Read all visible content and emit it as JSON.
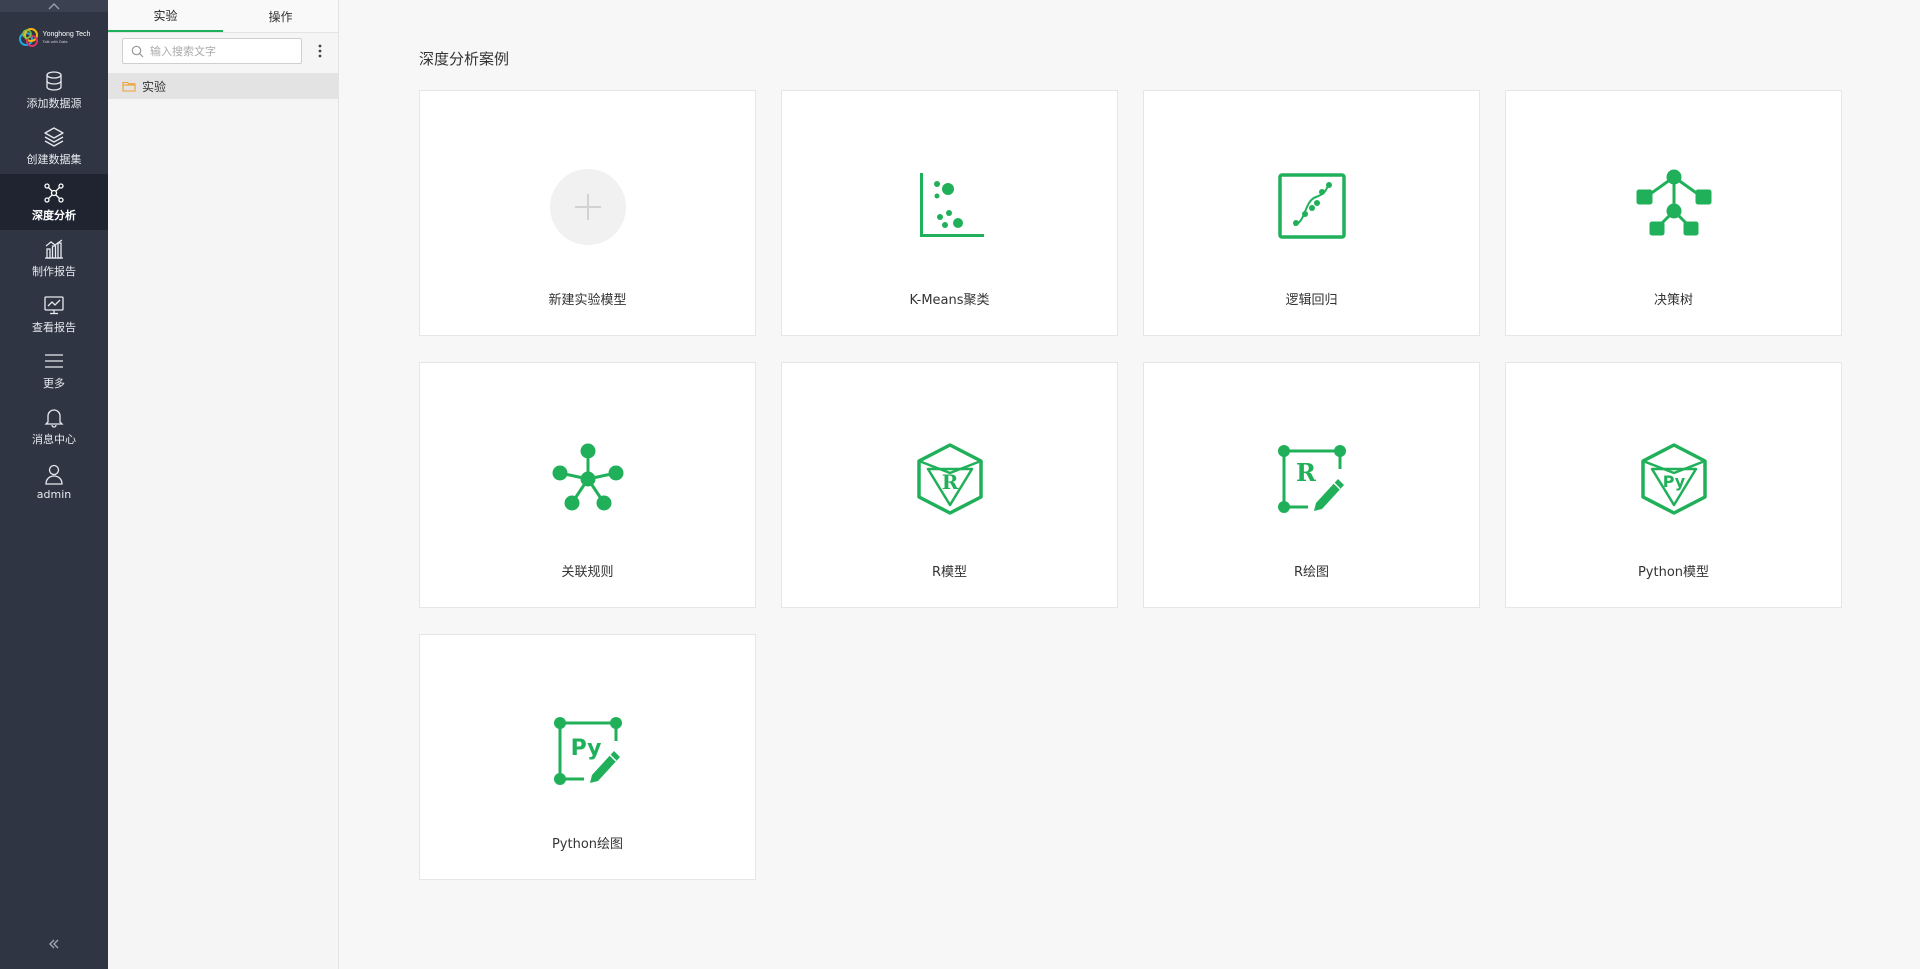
{
  "brand": {
    "name": "Yonghong Tech",
    "tagline": "Talk with Data"
  },
  "nav": {
    "items": [
      {
        "key": "add-datasource",
        "label": "添加数据源",
        "icon": "database-icon"
      },
      {
        "key": "create-dataset",
        "label": "创建数据集",
        "icon": "layers-icon"
      },
      {
        "key": "deep-analysis",
        "label": "深度分析",
        "icon": "network-icon",
        "active": true
      },
      {
        "key": "make-report",
        "label": "制作报告",
        "icon": "bar-chart-icon"
      },
      {
        "key": "view-report",
        "label": "查看报告",
        "icon": "monitor-chart-icon"
      },
      {
        "key": "more",
        "label": "更多",
        "icon": "menu-icon"
      },
      {
        "key": "messages",
        "label": "消息中心",
        "icon": "bell-icon"
      },
      {
        "key": "user",
        "label": "admin",
        "icon": "user-icon"
      }
    ]
  },
  "panel": {
    "tabs": [
      {
        "label": "实验",
        "active": true
      },
      {
        "label": "操作",
        "active": false
      }
    ],
    "search_placeholder": "输入搜索文字",
    "tree": [
      {
        "label": "实验",
        "icon": "folder-icon"
      }
    ]
  },
  "main": {
    "title": "深度分析案例",
    "cards": [
      {
        "label": "新建实验模型",
        "icon": "add-model-icon"
      },
      {
        "label": "K-Means聚类",
        "icon": "kmeans-icon"
      },
      {
        "label": "逻辑回归",
        "icon": "logistic-regression-icon"
      },
      {
        "label": "决策树",
        "icon": "decision-tree-icon"
      },
      {
        "label": "关联规则",
        "icon": "association-rules-icon"
      },
      {
        "label": "R模型",
        "icon": "r-model-icon"
      },
      {
        "label": "R绘图",
        "icon": "r-plot-icon"
      },
      {
        "label": "Python模型",
        "icon": "python-model-icon"
      },
      {
        "label": "Python绘图",
        "icon": "python-plot-icon"
      }
    ]
  },
  "colors": {
    "accent": "#20b05a",
    "nav_bg": "#2f3542",
    "nav_active": "#1f2430"
  }
}
